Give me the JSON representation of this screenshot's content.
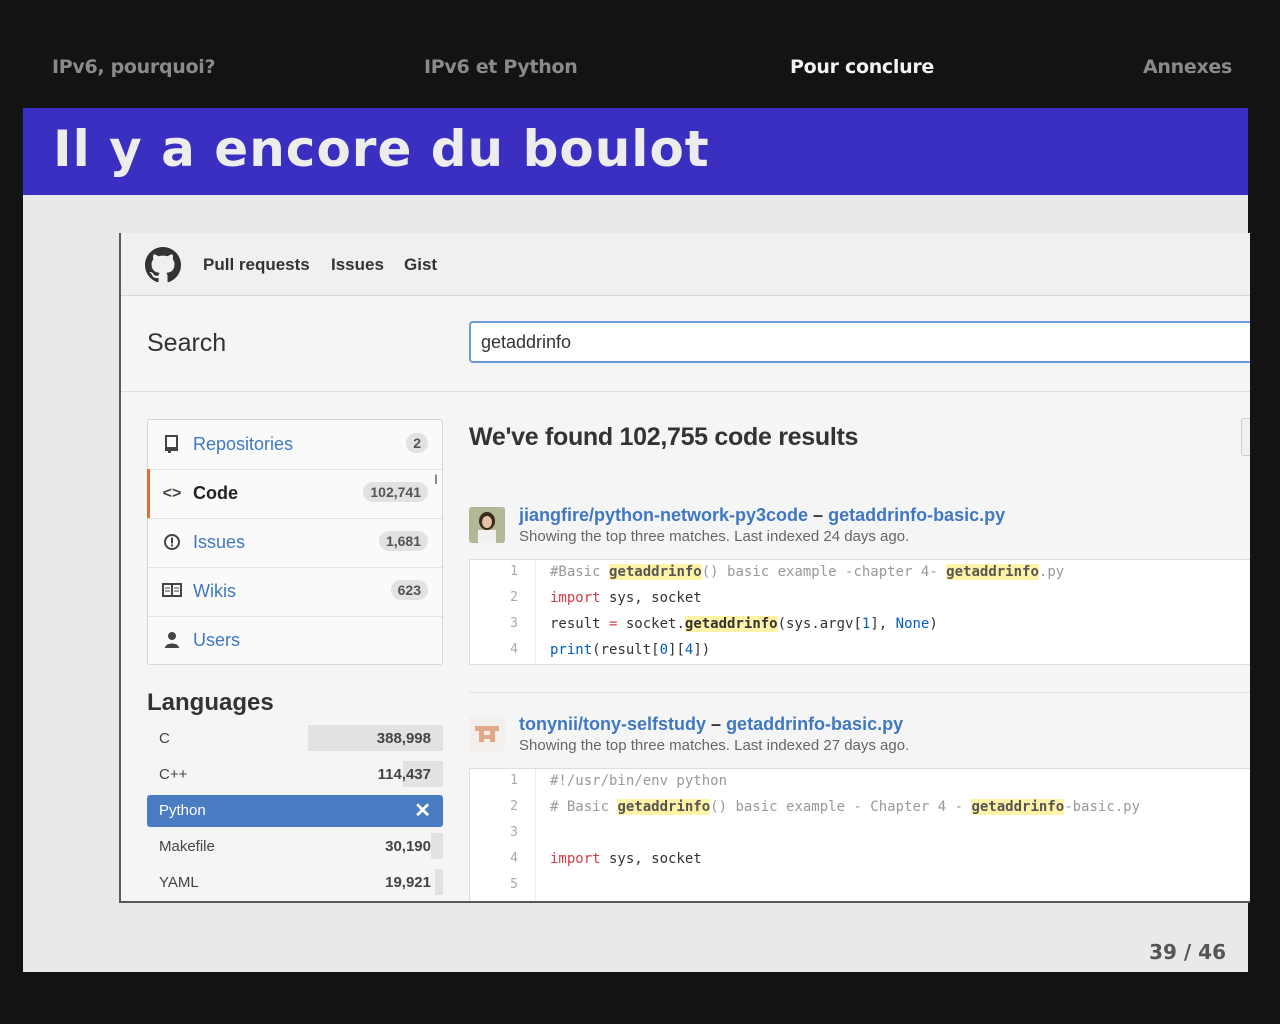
{
  "top_nav": {
    "items": [
      "IPv6, pourquoi?",
      "IPv6 et Python",
      "Pour conclure",
      "Annexes"
    ],
    "active_index": 2
  },
  "slide": {
    "title": "Il y a encore du boulot",
    "page": "39 / 46"
  },
  "github": {
    "header_links": [
      "Pull requests",
      "Issues",
      "Gist"
    ],
    "search": {
      "label": "Search",
      "value": "getaddrinfo"
    },
    "menu": [
      {
        "label": "Repositories",
        "count": "2",
        "icon": "repo-icon"
      },
      {
        "label": "Code",
        "count": "102,741",
        "icon": "code-icon",
        "selected": true
      },
      {
        "label": "Issues",
        "count": "1,681",
        "icon": "issue-icon"
      },
      {
        "label": "Wikis",
        "count": "623",
        "icon": "book-icon"
      },
      {
        "label": "Users",
        "count": "",
        "icon": "person-icon"
      }
    ],
    "languages": {
      "title": "Languages",
      "items": [
        {
          "name": "C",
          "count": "388,998",
          "share": 0.45
        },
        {
          "name": "C++",
          "count": "114,437",
          "share": 0.13
        },
        {
          "name": "Python",
          "count": "",
          "selected": true
        },
        {
          "name": "Makefile",
          "count": "30,190",
          "share": 0.035
        },
        {
          "name": "YAML",
          "count": "19,921",
          "share": 0.023
        }
      ]
    },
    "results_title": "We've found 102,755 code results",
    "results": [
      {
        "repo": "jiangfire/python-network-py3code",
        "sep": "–",
        "file": "getaddrinfo-basic.py",
        "subtitle": "Showing the top three matches. Last indexed 24 days ago.",
        "line_numbers": [
          "1",
          "2",
          "3",
          "4"
        ]
      },
      {
        "repo": "tonynii/tony-selfstudy",
        "sep": "–",
        "file": "getaddrinfo-basic.py",
        "subtitle": "Showing the top three matches. Last indexed 27 days ago.",
        "line_numbers": [
          "1",
          "2",
          "3",
          "4",
          "5"
        ]
      }
    ]
  }
}
